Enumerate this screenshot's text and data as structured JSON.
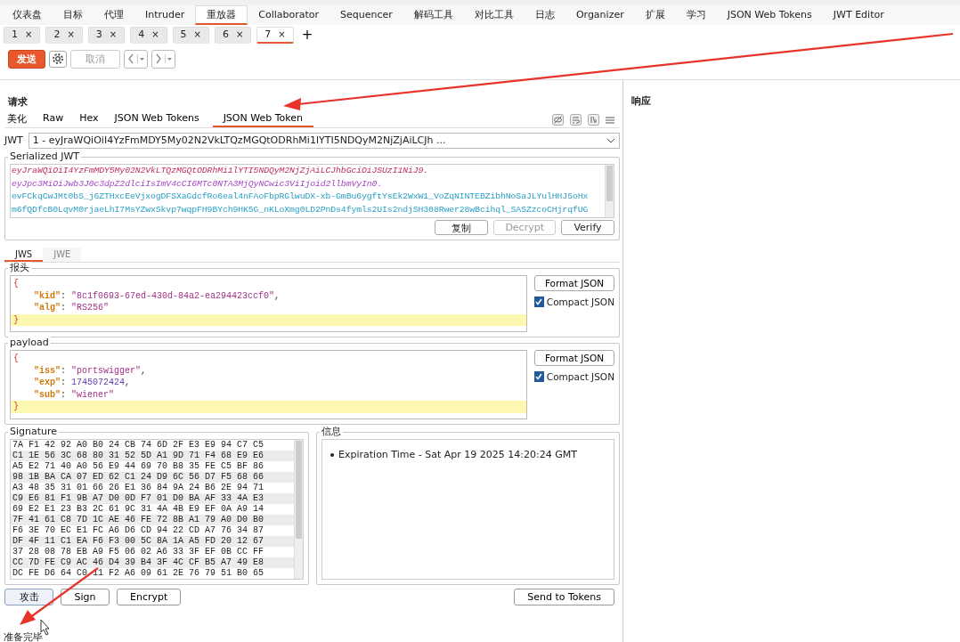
{
  "main_tabs": [
    {
      "label": "仪表盘",
      "selected": false
    },
    {
      "label": "目标",
      "selected": false
    },
    {
      "label": "代理",
      "selected": false
    },
    {
      "label": "Intruder",
      "selected": false
    },
    {
      "label": "重放器",
      "selected": true
    },
    {
      "label": "Collaborator",
      "selected": false
    },
    {
      "label": "Sequencer",
      "selected": false
    },
    {
      "label": "解码工具",
      "selected": false
    },
    {
      "label": "对比工具",
      "selected": false
    },
    {
      "label": "日志",
      "selected": false
    },
    {
      "label": "Organizer",
      "selected": false
    },
    {
      "label": "扩展",
      "selected": false
    },
    {
      "label": "学习",
      "selected": false
    },
    {
      "label": "JSON Web Tokens",
      "selected": false
    },
    {
      "label": "JWT Editor",
      "selected": false
    }
  ],
  "repeater_tabs": [
    {
      "label": "1",
      "close": "×",
      "selected": false
    },
    {
      "label": "2",
      "close": "×",
      "selected": false
    },
    {
      "label": "3",
      "close": "×",
      "selected": false
    },
    {
      "label": "4",
      "close": "×",
      "selected": false
    },
    {
      "label": "5",
      "close": "×",
      "selected": false
    },
    {
      "label": "6",
      "close": "×",
      "selected": false
    },
    {
      "label": "7",
      "close": "×",
      "selected": true
    }
  ],
  "add_tab": "+",
  "toolbar": {
    "send": "发送",
    "cancel": {
      "label": "取消",
      "disabled": true
    }
  },
  "request": {
    "title": "请求",
    "tabs": [
      {
        "label": "美化",
        "selected": false
      },
      {
        "label": "Raw",
        "selected": false
      },
      {
        "label": "Hex",
        "selected": false
      },
      {
        "label": "JSON Web Tokens",
        "selected": false
      },
      {
        "label": "JSON Web Token",
        "selected": true
      }
    ],
    "jwt_label": "JWT",
    "jwt_value": "1 - eyJraWQiOiI4YzFmMDY5My02N2VkLTQzMGQtODRhMi1lYTI5NDQyM2NjZjAiLCJh ...",
    "serialized": {
      "title": "Serialized JWT",
      "lines": [
        {
          "kind": "header",
          "text": "eyJraWQiOiI4YzFmMDY5My02N2VkLTQzMGQtODRhMi1lYTI5NDQyM2NjZjAiLCJhbGciOiJSUzI1NiJ9."
        },
        {
          "kind": "payload",
          "text": "eyJpc3MiOiJwb3J0c3dpZ2dlciIsImV4cCI6MTc0NTA3MjQyNCwic3ViIjoid2llbmVyIn0."
        },
        {
          "kind": "signature",
          "text": "evFCkqCwJMt0bS_j6ZTHxcEeVjxogDFSXaGdcfRo6eal4nFAoFbpRGlwuDX-xb-GmBu6ygftYsEk2WxW1_VoZqNINTEBZibhNoSaJLYulHHJ5oHx"
        },
        {
          "kind": "signature",
          "text": "m6fQDfcB0LqvM0rjaeLhI7MsYZwxSkvp7wqpFH9BYch9HK5G_nKLoXmg0LD2PnDs4fymls2UIs2ndjSH308Rwer28wBcihql_SASZzcoCHjrqfUG"
        }
      ],
      "buttons": [
        {
          "label": "复制",
          "disabled": false
        },
        {
          "label": "Decrypt",
          "disabled": true
        },
        {
          "label": "Verify",
          "disabled": false
        }
      ]
    },
    "mode_tabs": [
      {
        "label": "JWS",
        "selected": true
      },
      {
        "label": "JWE",
        "selected": false
      }
    ],
    "header": {
      "title": "报头",
      "lines": [
        {
          "highlighted": false,
          "tokens": [
            {
              "kind": "brace",
              "text": "{"
            }
          ]
        },
        {
          "highlighted": false,
          "tokens": [
            {
              "kind": "key",
              "text": "\"kid\""
            },
            {
              "kind": "punct",
              "text": ": "
            },
            {
              "kind": "string",
              "text": "\"8c1f0693-67ed-430d-84a2-ea294423ccf0\""
            },
            {
              "kind": "punct",
              "text": ","
            }
          ]
        },
        {
          "highlighted": false,
          "tokens": [
            {
              "kind": "key",
              "text": "\"alg\""
            },
            {
              "kind": "punct",
              "text": ": "
            },
            {
              "kind": "string",
              "text": "\"RS256\""
            }
          ]
        },
        {
          "highlighted": true,
          "tokens": [
            {
              "kind": "brace",
              "text": "}"
            }
          ]
        }
      ],
      "format": "Format JSON",
      "compact": {
        "label": "Compact JSON",
        "checked": true
      }
    },
    "payload": {
      "title": "payload",
      "lines": [
        {
          "highlighted": false,
          "tokens": [
            {
              "kind": "brace",
              "text": "{"
            }
          ]
        },
        {
          "highlighted": false,
          "tokens": [
            {
              "kind": "key",
              "text": "\"iss\""
            },
            {
              "kind": "punct",
              "text": ": "
            },
            {
              "kind": "string",
              "text": "\"portswigger\""
            },
            {
              "kind": "punct",
              "text": ","
            }
          ]
        },
        {
          "highlighted": false,
          "tokens": [
            {
              "kind": "key",
              "text": "\"exp\""
            },
            {
              "kind": "punct",
              "text": ": "
            },
            {
              "kind": "number",
              "text": "1745072424"
            },
            {
              "kind": "punct",
              "text": ","
            }
          ]
        },
        {
          "highlighted": false,
          "tokens": [
            {
              "kind": "key",
              "text": "\"sub\""
            },
            {
              "kind": "punct",
              "text": ": "
            },
            {
              "kind": "string",
              "text": "\"wiener\""
            }
          ]
        },
        {
          "highlighted": true,
          "tokens": [
            {
              "kind": "brace",
              "text": "}"
            }
          ]
        }
      ],
      "format": "Format JSON",
      "compact": {
        "label": "Compact JSON",
        "checked": true
      }
    },
    "signature": {
      "title": "Signature",
      "rows": [
        "7A F1 42 92 A0 B0 24 CB 74 6D 2F E3 E9 94 C7 C5",
        "C1 1E 56 3C 68 80 31 52 5D A1 9D 71 F4 68 E9 E6",
        "A5 E2 71 40 A0 56 E9 44 69 70 B8 35 FE C5 BF 86",
        "98 1B BA CA 07 ED 62 C1 24 D9 6C 56 D7 F5 68 66",
        "A3 48 35 31 01 66 26 E1 36 84 9A 24 B6 2E 94 71",
        "C9 E6 81 F1 9B A7 D0 0D F7 01 D0 BA AF 33 4A E3",
        "69 E2 E1 23 B3 2C 61 9C 31 4A 4B E9 EF 0A A9 14",
        "7F 41 61 C8 7D 1C AE 46 FE 72 8B A1 79 A0 D0 B0",
        "F6 3E 70 EC E1 FC A6 D6 CD 94 22 CD A7 76 34 87",
        "DF 4F 11 C1 EA F6 F3 00 5C 8A 1A A5 FD 20 12 67",
        "37 28 08 78 EB A9 F5 06 02 A6 33 3F EF 0B CC FF",
        "CC 7D FE C9 AC 46 D4 39 B4 3F 4C CF B5 A7 49 E8",
        "DC FE D6 64 C0 11 F2 A6 09 61 2E 76 79 51 B0 65"
      ]
    },
    "info": {
      "title": "信息",
      "items": [
        "Expiration Time - Sat Apr 19 2025 14:20:24 GMT"
      ]
    },
    "actions": [
      "攻击",
      "Sign",
      "Encrypt"
    ],
    "send_to_tokens": "Send to Tokens"
  },
  "response": {
    "title": "响应"
  },
  "status": "准备完毕"
}
